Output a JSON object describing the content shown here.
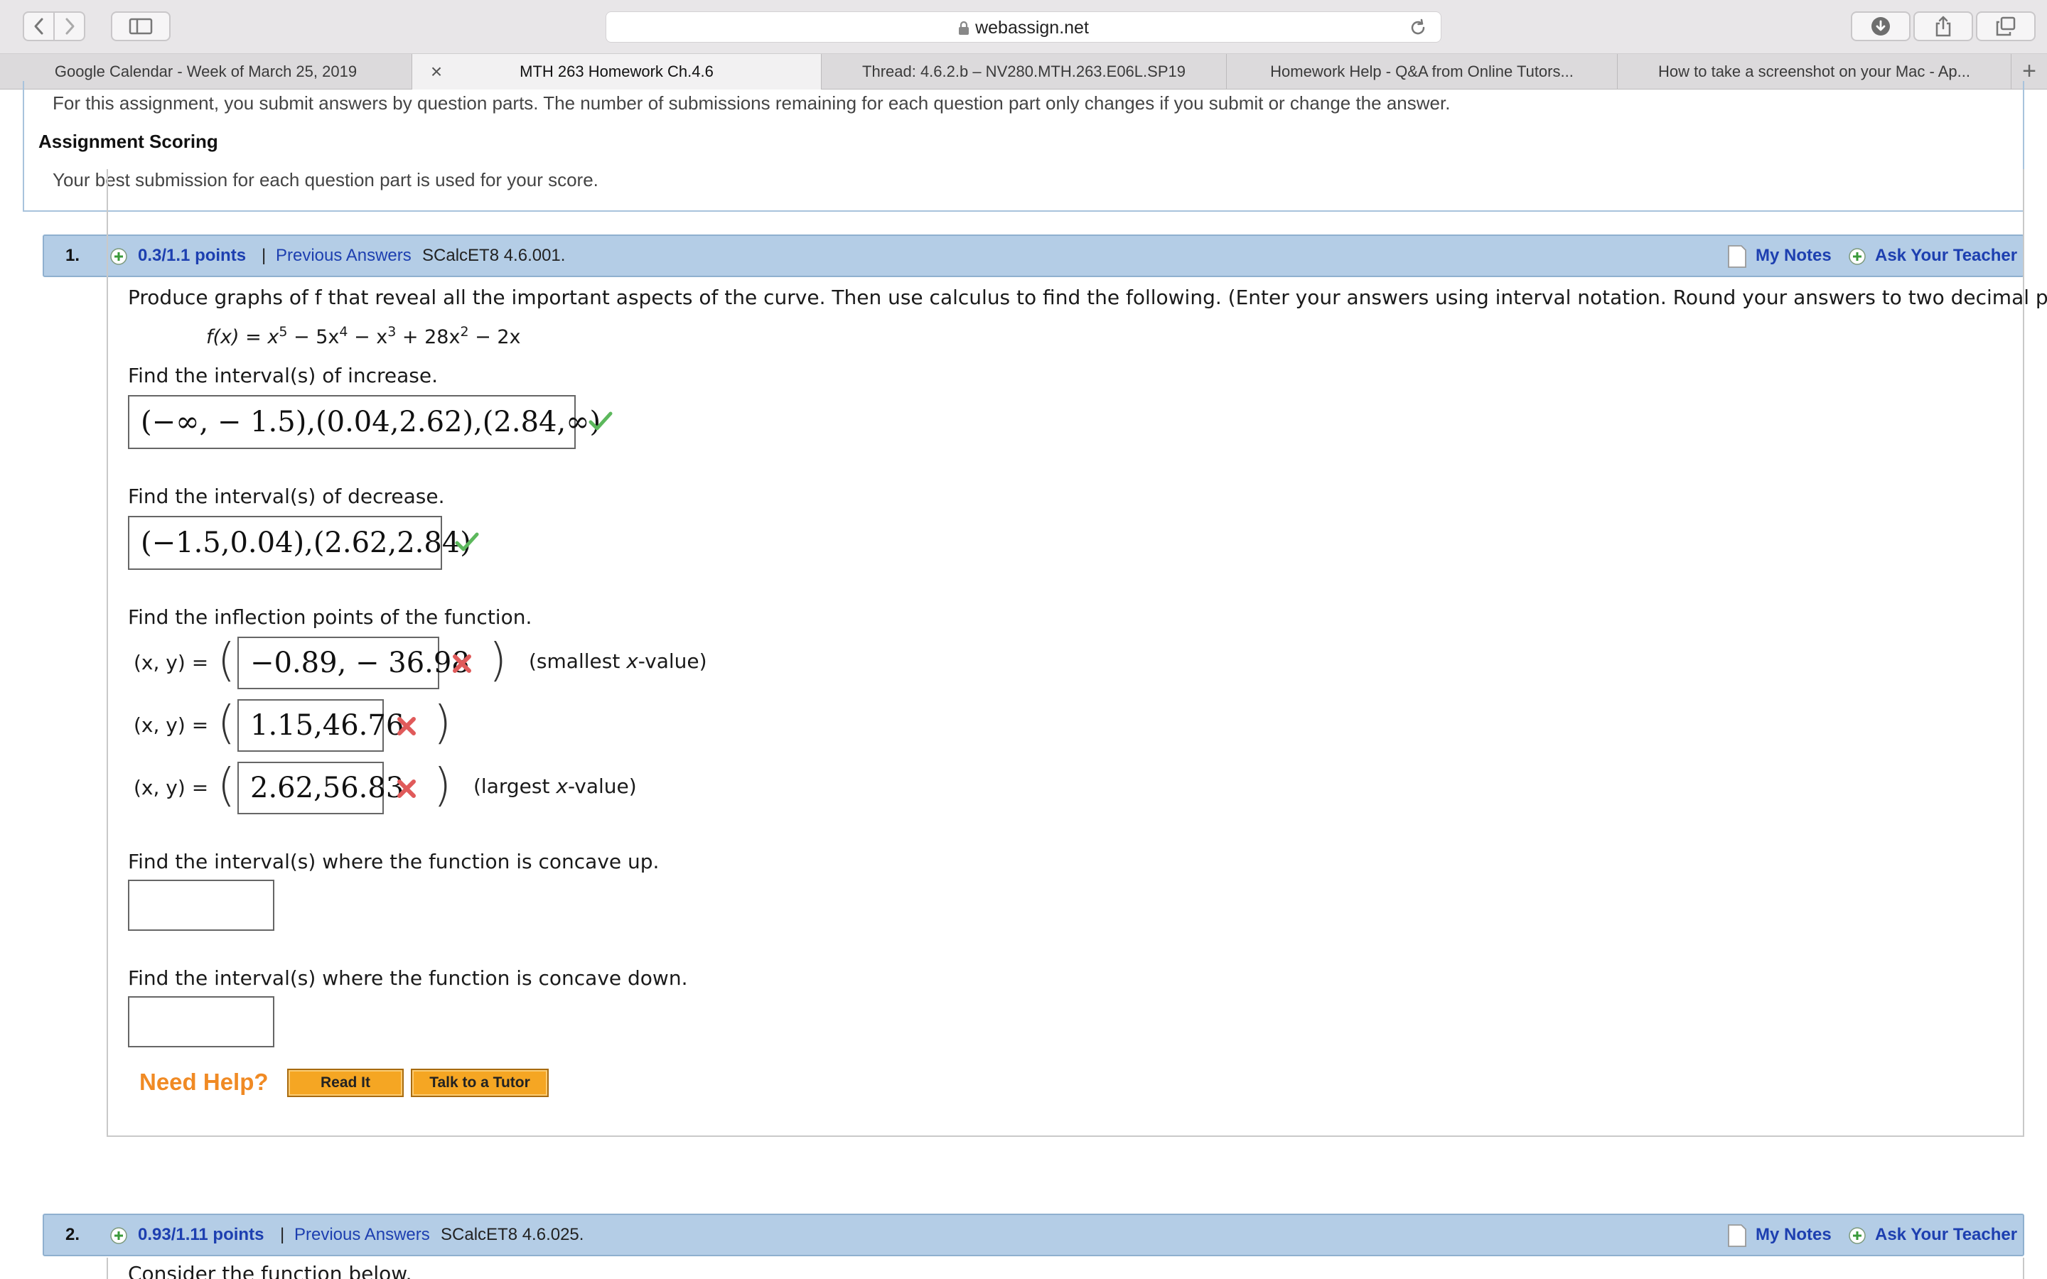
{
  "browser": {
    "address": "webassign.net",
    "tabs": [
      {
        "label": "Google Calendar - Week of March 25, 2019",
        "active": false
      },
      {
        "label": "MTH 263 Homework Ch.4.6",
        "active": true
      },
      {
        "label": "Thread: 4.6.2.b – NV280.MTH.263.E06L.SP19",
        "active": false
      },
      {
        "label": "Homework Help - Q&A from Online Tutors...",
        "active": false
      },
      {
        "label": "How to take a screenshot on your Mac - Ap...",
        "active": false
      }
    ],
    "tab_close": "×",
    "new_tab": "+"
  },
  "info": {
    "submission_text": "For this assignment, you submit answers by question parts. The number of submissions remaining for each question part only changes if you submit or change the answer.",
    "scoring_heading": "Assignment Scoring",
    "scoring_text": "Your best submission for each question part is used for your score."
  },
  "q1": {
    "number": "1.",
    "points": "0.3/1.1 points",
    "separator": "|",
    "previous": "Previous Answers",
    "code": "SCalcET8 4.6.001.",
    "my_notes": "My Notes",
    "ask_teacher": "Ask Your Teacher",
    "prompt": "Produce graphs of f that reveal all the important aspects of the curve. Then use calculus to find the following. (Enter your answers using interval notation. Round your answers to two decimal places.)",
    "function": {
      "lhs": "f(x) = x",
      "e1": "5",
      "t2": " − 5x",
      "e2": "4",
      "t3": " − x",
      "e3": "3",
      "t4": " + 28x",
      "e4": "2",
      "t5": " − 2x"
    },
    "increase_label": "Find the interval(s) of increase.",
    "increase_answer": "(−∞, − 1.5),(0.04,2.62),(2.84,∞)",
    "increase_status": "correct",
    "decrease_label": "Find the interval(s) of decrease.",
    "decrease_answer": "(−1.5,0.04),(2.62,2.84)",
    "decrease_status": "correct",
    "inflection_label": "Find the inflection points of the function.",
    "xy_label": "(x, y) =",
    "inflection_answers": [
      "−0.89, − 36.98",
      "1.15,46.76",
      "2.62,56.83"
    ],
    "inflection_status": [
      "incorrect",
      "incorrect",
      "incorrect"
    ],
    "smallest_note": {
      "pre": "(smallest ",
      "var": "x",
      "post": "-value)"
    },
    "largest_note": {
      "pre": "(largest ",
      "var": "x",
      "post": "-value)"
    },
    "concave_up_label": "Find the interval(s) where the function is concave up.",
    "concave_up_value": "",
    "concave_down_label": "Find the interval(s) where the function is concave down.",
    "concave_down_value": "",
    "need_help": "Need Help?",
    "read_it": "Read It",
    "talk_tutor": "Talk to a Tutor"
  },
  "q2": {
    "number": "2.",
    "points": "0.93/1.11 points",
    "separator": "|",
    "previous": "Previous Answers",
    "code": "SCalcET8 4.6.025.",
    "my_notes": "My Notes",
    "ask_teacher": "Ask Your Teacher",
    "prompt_partial": "Consider the function below."
  },
  "colors": {
    "header_bg": "#b4cde6",
    "link_blue": "#1d3fb0",
    "check_green": "#5cb85c",
    "cross_red": "#e05a5a",
    "help_orange": "#f08a24"
  },
  "icons": [
    "chevron-left-icon",
    "chevron-right-icon",
    "sidebar-icon",
    "lock-icon",
    "reload-icon",
    "download-icon",
    "share-icon",
    "tabs-overview-icon",
    "plus-circle-icon",
    "note-icon",
    "check-icon",
    "cross-icon"
  ]
}
